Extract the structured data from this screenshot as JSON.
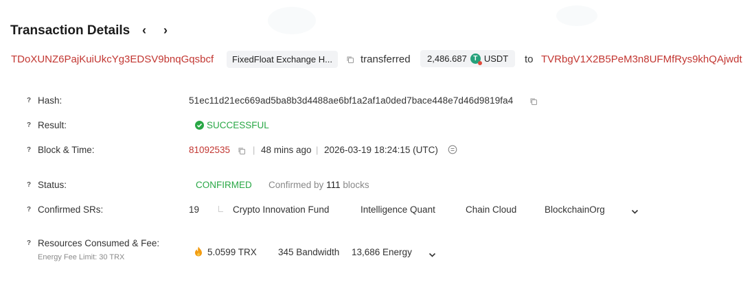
{
  "header": {
    "title": "Transaction Details",
    "prev_glyph": "‹",
    "next_glyph": "›"
  },
  "summary": {
    "from_address": "TDoXUNZ6PajKuiUkcYg3EDSV9bnqGqsbcf",
    "from_tag": "FixedFloat Exchange H...",
    "action": "transferred",
    "amount": "2,486.687",
    "token_symbol": "USDT",
    "to_word": "to",
    "to_address": "TVRbgV1X2B5PeM3n8UFMfRys9khQAjwdt"
  },
  "details": {
    "hash_label": "Hash:",
    "hash_value": "51ec11d21ec669ad5ba8b3d4488ae6bf1a2af1a0ded7bace448e7d46d9819fa4",
    "result_label": "Result:",
    "result_value": "SUCCESSFUL",
    "block_label": "Block & Time:",
    "block_number": "81092535",
    "age": "48 mins ago",
    "timestamp": "2026-03-19 18:24:15 (UTC)",
    "status_label": "Status:",
    "status_value": "CONFIRMED",
    "confirmed_prefix": "Confirmed by",
    "confirmed_count": "111",
    "confirmed_suffix": "blocks",
    "srs_label": "Confirmed SRs:",
    "srs_count": "19",
    "srs": [
      "Crypto Innovation Fund",
      "Intelligence Quant",
      "Chain Cloud",
      "BlockchainOrg"
    ],
    "resources_label": "Resources Consumed & Fee:",
    "energy_fee_limit": "Energy Fee Limit: 30 TRX",
    "fee_trx": "5.0599 TRX",
    "bandwidth": "345 Bandwidth",
    "energy": "13,686 Energy"
  },
  "colors": {
    "address": "#c23631",
    "success": "#28a745",
    "tether": "#26a17b"
  },
  "icons": {
    "help": "question-icon",
    "copy": "copy-icon",
    "success": "check-circle-icon",
    "fee": "flame-icon",
    "token": "tether-icon",
    "expand": "chevron-down-icon",
    "clock": "clock-icon"
  }
}
